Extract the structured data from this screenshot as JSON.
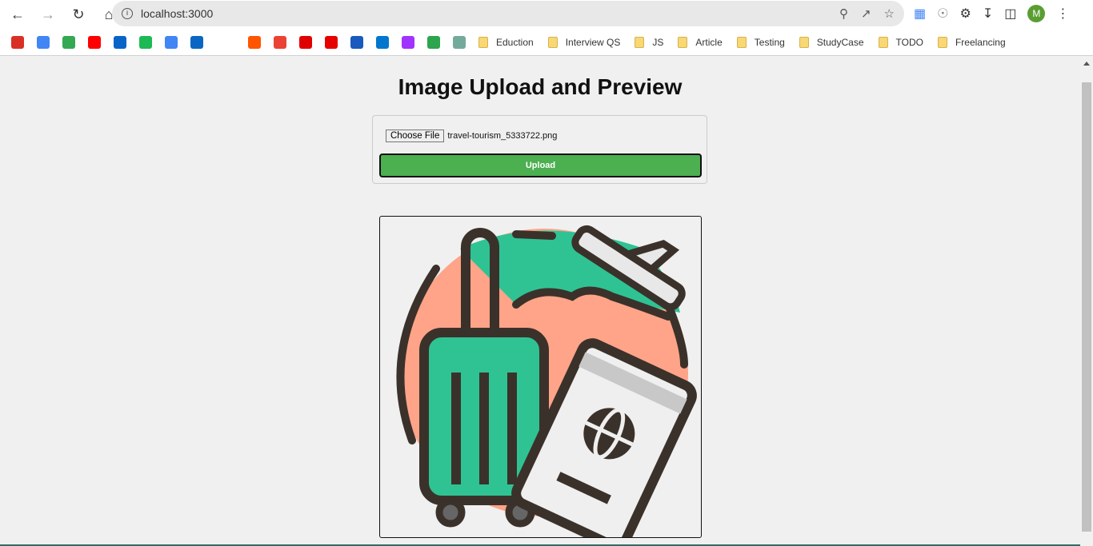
{
  "browser": {
    "url": "localhost:3000",
    "avatar_letter": "M",
    "bookmark_folders": [
      "Eduction",
      "Interview QS",
      "JS",
      "Article",
      "Testing",
      "StudyCase",
      "TODO",
      "Freelancing"
    ],
    "bookmark_colors": [
      "#d93025",
      "#4285f4",
      "#34a853",
      "#ff0000",
      "#0a64c8",
      "#1db954",
      "#4285f4",
      "#0a66c2",
      "#ff5500",
      "#ea4335",
      "#e00000",
      "#e60000",
      "#185abd",
      "#0076ce",
      "#a033ff",
      "#2da44e",
      "#74aa9c"
    ]
  },
  "page": {
    "title": "Image Upload and Preview",
    "choose_file_label": "Choose File",
    "file_name": "travel-tourism_5333722.png",
    "upload_label": "Upload"
  },
  "colors": {
    "accent": "#4caf50"
  }
}
